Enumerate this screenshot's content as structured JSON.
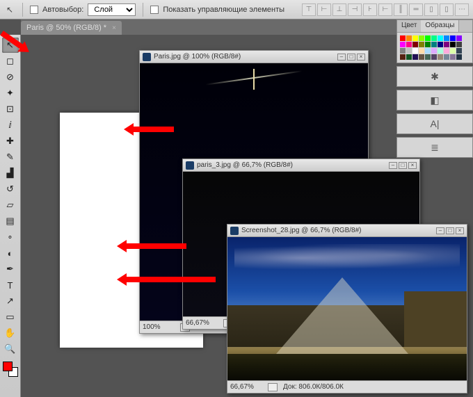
{
  "options": {
    "auto_select_label": "Автовыбор:",
    "auto_select_value": "Слой",
    "show_controls_label": "Показать управляющие элементы"
  },
  "tab": {
    "title": "Paris @ 50% (RGB/8) *"
  },
  "tools": [
    {
      "id": "move",
      "glyph": "↖"
    },
    {
      "id": "marquee",
      "glyph": "◻"
    },
    {
      "id": "lasso",
      "glyph": "⊘"
    },
    {
      "id": "wand",
      "glyph": "✦"
    },
    {
      "id": "crop",
      "glyph": "⊡"
    },
    {
      "id": "eyedropper",
      "glyph": "ⅈ"
    },
    {
      "id": "heal",
      "glyph": "✚"
    },
    {
      "id": "brush",
      "glyph": "✎"
    },
    {
      "id": "stamp",
      "glyph": "▟"
    },
    {
      "id": "history",
      "glyph": "↺"
    },
    {
      "id": "eraser",
      "glyph": "▱"
    },
    {
      "id": "gradient",
      "glyph": "▤"
    },
    {
      "id": "blur",
      "glyph": "∘"
    },
    {
      "id": "dodge",
      "glyph": "◐"
    },
    {
      "id": "pen",
      "glyph": "✒"
    },
    {
      "id": "type",
      "glyph": "T"
    },
    {
      "id": "path",
      "glyph": "↗"
    },
    {
      "id": "shape",
      "glyph": "▭"
    },
    {
      "id": "3d",
      "glyph": "⬚"
    },
    {
      "id": "hand",
      "glyph": "✋"
    },
    {
      "id": "zoom",
      "glyph": "🔍"
    }
  ],
  "panels": {
    "color_tab": "Цвет",
    "swatches_tab": "Образцы",
    "character_icon": "A|"
  },
  "swatch_colors": [
    "#ff0000",
    "#ff8800",
    "#ffff00",
    "#88ff00",
    "#00ff00",
    "#00ff88",
    "#00ffff",
    "#0088ff",
    "#0000ff",
    "#8800ff",
    "#ff00ff",
    "#ff0088",
    "#800000",
    "#808000",
    "#008000",
    "#008080",
    "#000080",
    "#800080",
    "#000000",
    "#404040",
    "#808080",
    "#c0c0c0",
    "#ffffff",
    "#ffddaa",
    "#aaddff",
    "#ddaaff",
    "#aaffdd",
    "#ffaadd",
    "#ddffaa",
    "#334455",
    "#552211",
    "#115522",
    "#221155",
    "#665544",
    "#446655",
    "#554466",
    "#998877",
    "#778899",
    "#887799",
    "#223344"
  ],
  "windows": {
    "w1": {
      "title": "Paris.jpg @ 100% (RGB/8#)",
      "zoom": "100%"
    },
    "w2": {
      "title": "paris_3.jpg @ 66,7% (RGB/8#)",
      "zoom": "66,67%"
    },
    "w3": {
      "title": "Screenshot_28.jpg @ 66,7% (RGB/8#)",
      "zoom": "66,67%",
      "doc_info": "Док: 806.0К/806.0К"
    }
  }
}
